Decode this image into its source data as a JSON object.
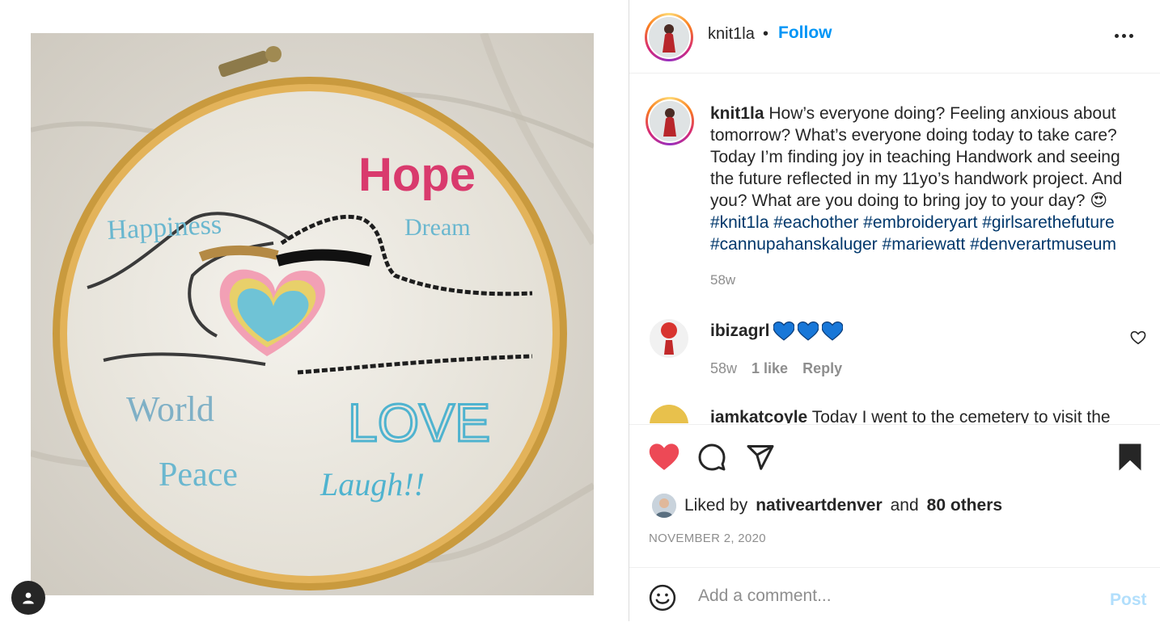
{
  "post_image": {
    "embroidery_words": [
      "Hope",
      "Happiness",
      "Dream",
      "World",
      "Peace",
      "LOVE",
      "Laugh!!"
    ]
  },
  "header": {
    "username": "knit1la",
    "separator": "•",
    "follow_label": "Follow"
  },
  "caption": {
    "username": "knit1la",
    "text": "How’s everyone doing? Feeling anxious about tomorrow? What’s everyone doing today to take care? Today I’m finding joy in teaching Handwork and seeing the future reflected in my 11yo’s handwork project. And you? What are you doing to bring joy to your day? 😍",
    "hashtags": [
      "#knit1la",
      "#eachother",
      "#embroideryart",
      "#girlsarethefuture",
      "#cannupahanskaluger",
      "#mariewatt",
      "#denverartmuseum"
    ],
    "time": "58w"
  },
  "comments": [
    {
      "username": "ibizagrl",
      "text": "💙💙💙",
      "time": "58w",
      "likes": "1 like",
      "reply_label": "Reply"
    },
    {
      "username": "iamkatcoyle",
      "text": "Today I went to the cemetery to visit the"
    }
  ],
  "likes": {
    "prefix": "Liked by",
    "user": "nativeartdenver",
    "joiner": "and",
    "others": "80 others"
  },
  "date": "NOVEMBER 2, 2020",
  "comment_box": {
    "placeholder": "Add a comment...",
    "post_label": "Post"
  },
  "colors": {
    "follow": "#0095f6",
    "liked_heart": "#ed4956",
    "hashtag": "#00376b",
    "post_disabled": "#b2dffc"
  }
}
